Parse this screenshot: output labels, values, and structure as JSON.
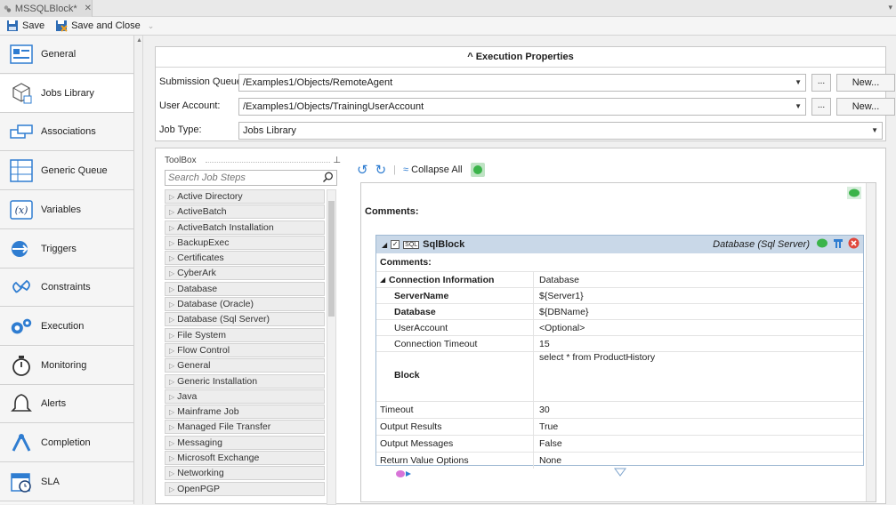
{
  "tab": {
    "title": "MSSQLBlock*",
    "close": "✕",
    "menu": "▾"
  },
  "toolbar": {
    "save_label": "Save",
    "save_close_label": "Save and Close",
    "more": "⌄"
  },
  "nav": {
    "items": [
      {
        "label": "General",
        "icon": "general-icon"
      },
      {
        "label": "Jobs Library",
        "icon": "jobs-library-icon"
      },
      {
        "label": "Associations",
        "icon": "associations-icon"
      },
      {
        "label": "Generic Queue",
        "icon": "generic-queue-icon"
      },
      {
        "label": "Variables",
        "icon": "variables-icon"
      },
      {
        "label": "Triggers",
        "icon": "triggers-icon"
      },
      {
        "label": "Constraints",
        "icon": "constraints-icon"
      },
      {
        "label": "Execution",
        "icon": "execution-icon"
      },
      {
        "label": "Monitoring",
        "icon": "monitoring-icon"
      },
      {
        "label": "Alerts",
        "icon": "alerts-icon"
      },
      {
        "label": "Completion",
        "icon": "completion-icon"
      },
      {
        "label": "SLA",
        "icon": "sla-icon"
      }
    ]
  },
  "execution": {
    "header": "Execution Properties",
    "collapse_glyph": "^",
    "submission_queue": {
      "label": "Submission Queue:",
      "value": "/Examples1/Objects/RemoteAgent",
      "browse": "...",
      "new": "New..."
    },
    "user_account": {
      "label": "User Account:",
      "value": "/Examples1/Objects/TrainingUserAccount",
      "browse": "...",
      "new": "New..."
    },
    "job_type": {
      "label": "Job Type:",
      "value": "Jobs Library"
    }
  },
  "toolbox": {
    "title": "ToolBox",
    "pin": "⊥",
    "search_placeholder": "Search Job Steps",
    "categories": [
      "Active Directory",
      "ActiveBatch",
      "ActiveBatch Installation",
      "BackupExec",
      "Certificates",
      "CyberArk",
      "Database",
      "Database (Oracle)",
      "Database (Sql Server)",
      "File System",
      "Flow Control",
      "General",
      "Generic Installation",
      "Java",
      "Mainframe Job",
      "Managed File Transfer",
      "Messaging",
      "Microsoft Exchange",
      "Networking",
      "OpenPGP"
    ]
  },
  "designer": {
    "collapse_all": "Collapse All",
    "comments_label": "Comments:",
    "block": {
      "name": "SqlBlock",
      "type": "Database (Sql Server)",
      "comments_label": "Comments:",
      "rows": [
        {
          "name": "Connection Information",
          "value": "Database",
          "style": "group"
        },
        {
          "name": "ServerName",
          "value": "${Server1}",
          "style": "bold"
        },
        {
          "name": "Database",
          "value": "${DBName}",
          "style": "bold"
        },
        {
          "name": "UserAccount",
          "value": "<Optional>",
          "style": "normal"
        },
        {
          "name": "Connection Timeout",
          "value": "15",
          "style": "normal"
        },
        {
          "name": "Block",
          "value": "select * from ProductHistory",
          "style": "block"
        },
        {
          "name": "Timeout",
          "value": "30",
          "style": "top"
        },
        {
          "name": "Output Results",
          "value": "True",
          "style": "top"
        },
        {
          "name": "Output Messages",
          "value": "False",
          "style": "top"
        },
        {
          "name": "Return Value Options",
          "value": "None",
          "style": "top"
        }
      ]
    }
  },
  "colors": {
    "accent": "#2f7dd1",
    "block_header": "#c9d8e8",
    "green": "#3bb44a",
    "red": "#e0473c"
  }
}
